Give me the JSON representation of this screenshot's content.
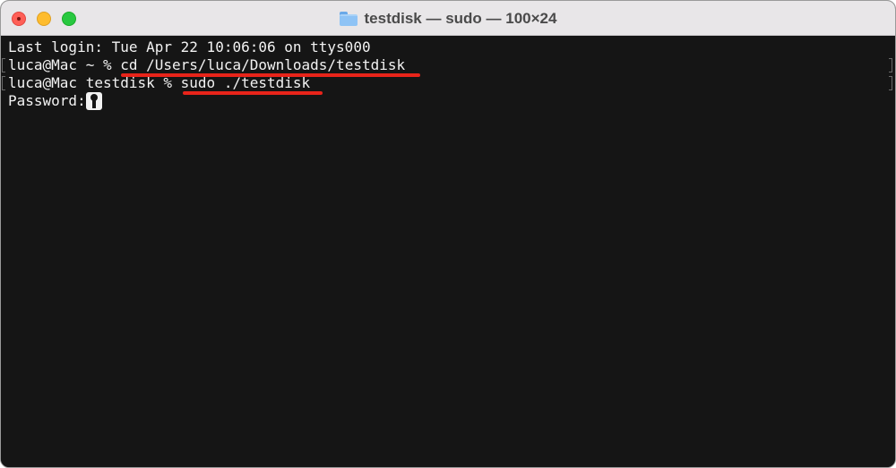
{
  "window": {
    "title": "testdisk — sudo — 100×24",
    "title_icon": "folder-icon",
    "controls": {
      "close": "close-button",
      "minimize": "minimize-button",
      "zoom": "zoom-button"
    }
  },
  "terminal": {
    "lines": [
      {
        "text": "Last login: Tue Apr 22 10:06:06 on ttys000"
      },
      {
        "prompt": "luca@Mac ~ % ",
        "command": "cd /Users/luca/Downloads/testdisk"
      },
      {
        "prompt": "luca@Mac testdisk % ",
        "command": "sudo ./testdisk"
      },
      {
        "text": "Password:"
      }
    ],
    "cursor_icon": "key-icon"
  },
  "colors": {
    "terminal_background": "#151515",
    "terminal_text": "#f2f2f2",
    "highlight_underline": "#e8241a",
    "titlebar": "#e8e6e8"
  }
}
